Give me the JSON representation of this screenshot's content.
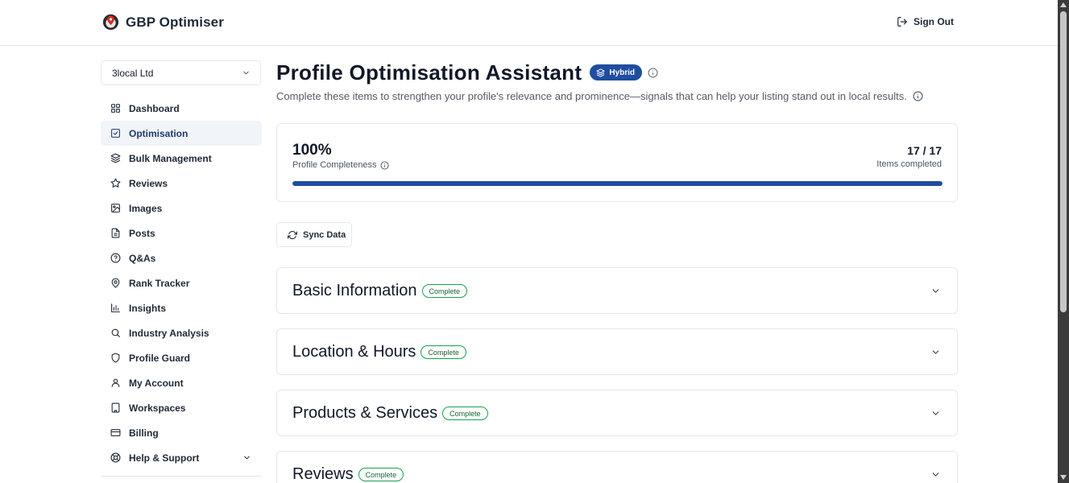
{
  "header": {
    "app_title": "GBP Optimiser",
    "logo_icon": "map-pin-logo-icon",
    "sign_out_label": "Sign Out",
    "brand_color": "#1e4ea0"
  },
  "sidebar": {
    "workspace": "3local Ltd",
    "items": [
      {
        "label": "Dashboard",
        "icon": "grid-icon",
        "active": false
      },
      {
        "label": "Optimisation",
        "icon": "checkbox-icon",
        "active": true
      },
      {
        "label": "Bulk Management",
        "icon": "layers-icon",
        "active": false
      },
      {
        "label": "Reviews",
        "icon": "star-icon",
        "active": false
      },
      {
        "label": "Images",
        "icon": "image-icon",
        "active": false
      },
      {
        "label": "Posts",
        "icon": "document-icon",
        "active": false
      },
      {
        "label": "Q&As",
        "icon": "question-icon",
        "active": false
      },
      {
        "label": "Rank Tracker",
        "icon": "map-pin-icon",
        "active": false
      },
      {
        "label": "Insights",
        "icon": "bar-chart-icon",
        "active": false
      },
      {
        "label": "Industry Analysis",
        "icon": "search-icon",
        "active": false
      },
      {
        "label": "Profile Guard",
        "icon": "shield-icon",
        "active": false
      },
      {
        "label": "My Account",
        "icon": "user-icon",
        "active": false
      },
      {
        "label": "Workspaces",
        "icon": "building-icon",
        "active": false
      },
      {
        "label": "Billing",
        "icon": "credit-card-icon",
        "active": false
      },
      {
        "label": "Help & Support",
        "icon": "lifebuoy-icon",
        "active": false
      }
    ]
  },
  "main": {
    "title": "Profile Optimisation Assistant",
    "badge": "Hybrid",
    "subtitle": "Complete these items to strengthen your profile's relevance and prominence—signals that can help your listing stand out in local results.",
    "progress": {
      "percent_label": "100%",
      "percent_value": 100,
      "percent_caption": "Profile Completeness",
      "count_label": "17 / 17",
      "count_caption": "Items completed"
    },
    "sync_label": "Sync Data",
    "sections": [
      {
        "title": "Basic Information",
        "status": "Complete"
      },
      {
        "title": "Location & Hours",
        "status": "Complete"
      },
      {
        "title": "Products & Services",
        "status": "Complete"
      },
      {
        "title": "Reviews",
        "status": "Complete"
      }
    ]
  }
}
